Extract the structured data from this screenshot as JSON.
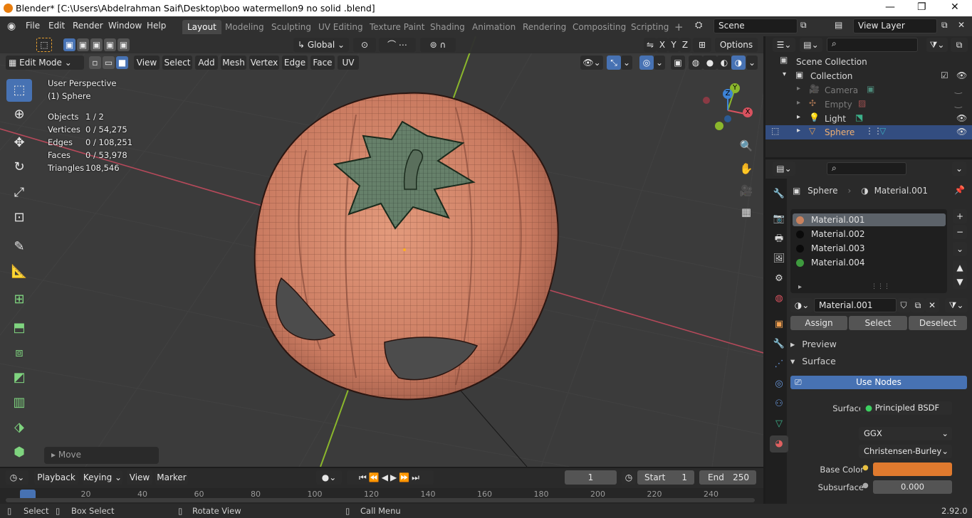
{
  "window_title": "Blender* [C:\\Users\\Abdelrahman Saif\\Desktop\\boo watermellon9 no solid .blend]",
  "window_controls": {
    "minimize": "—",
    "maximize": "❐",
    "close": "✕"
  },
  "menu": [
    "File",
    "Edit",
    "Render",
    "Window",
    "Help"
  ],
  "workspaces": [
    "Layout",
    "Modeling",
    "Sculpting",
    "UV Editing",
    "Texture Paint",
    "Shading",
    "Animation",
    "Rendering",
    "Compositing",
    "Scripting"
  ],
  "add_workspace": "+",
  "scene": "Scene",
  "view_layer": "View Layer",
  "viewport_header": {
    "transform_orientation": "Global",
    "axes": [
      "X",
      "Y",
      "Z"
    ],
    "options": "Options",
    "mode": "Edit Mode",
    "menus": [
      "View",
      "Select",
      "Add",
      "Mesh",
      "Vertex",
      "Edge",
      "Face",
      "UV"
    ]
  },
  "overlay_info": {
    "perspective": "User Perspective",
    "object": "(1) Sphere",
    "stats": [
      {
        "label": "Objects",
        "value": "1 / 2"
      },
      {
        "label": "Vertices",
        "value": "0 / 54,275"
      },
      {
        "label": "Edges",
        "value": "0 / 108,251"
      },
      {
        "label": "Faces",
        "value": "0 / 53,978"
      },
      {
        "label": "Triangles",
        "value": "108,546"
      }
    ]
  },
  "last_operator": "Move",
  "gizmo_axes": {
    "x": "X",
    "y": "Y",
    "z": "Z"
  },
  "colors": {
    "accent": "#4772b3",
    "x_axis": "#d9525f",
    "y_axis": "#8bb72c",
    "z_axis": "#3d83d6",
    "mesh": "#d9846b",
    "leaf": "#66806a",
    "base_color": "#e07a2e"
  },
  "timeline": {
    "menus": [
      "Playback",
      "Keying",
      "View",
      "Marker"
    ],
    "current_frame": "1",
    "start_label": "Start",
    "start": "1",
    "end_label": "End",
    "end": "250",
    "ruler": [
      "0",
      "20",
      "40",
      "60",
      "80",
      "100",
      "120",
      "140",
      "160",
      "180",
      "200",
      "220",
      "240"
    ]
  },
  "status_bar": {
    "select": "Select",
    "box_select": "Box Select",
    "rotate": "Rotate View",
    "call_menu": "Call Menu",
    "version": "2.92.0"
  },
  "outliner": {
    "root": "Scene Collection",
    "collection": "Collection",
    "items": [
      {
        "name": "Camera",
        "icon": "camera-icon"
      },
      {
        "name": "Empty",
        "icon": "empty-icon"
      },
      {
        "name": "Light",
        "icon": "light-icon"
      },
      {
        "name": "Sphere",
        "icon": "mesh-icon"
      }
    ]
  },
  "properties": {
    "breadcrumb_object": "Sphere",
    "breadcrumb_material": "Material.001",
    "slots": [
      {
        "name": "Material.001",
        "color": "#c9825e"
      },
      {
        "name": "Material.002",
        "color": "#0a0a0a"
      },
      {
        "name": "Material.003",
        "color": "#0a0a0a"
      },
      {
        "name": "Material.004",
        "color": "#3e9a3e"
      }
    ],
    "material_name": "Material.001",
    "assign": "Assign",
    "select": "Select",
    "deselect": "Deselect",
    "preview": "Preview",
    "surface_panel": "Surface",
    "use_nodes": "Use Nodes",
    "surface_label": "Surface",
    "surface_value": "Principled BSDF",
    "distribution": "GGX",
    "subsurface_method": "Christensen-Burley",
    "base_color_label": "Base Color",
    "subsurface_label": "Subsurface",
    "subsurface_value": "0.000"
  }
}
